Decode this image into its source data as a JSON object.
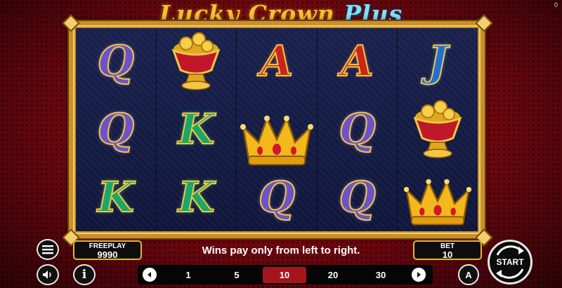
{
  "game": {
    "title_main": "Lucky Crown ",
    "title_plus": "Plus",
    "corner_counter": "0"
  },
  "reels": [
    [
      "Q",
      "Q",
      "K"
    ],
    [
      "pot-of-gold",
      "K",
      "K"
    ],
    [
      "A",
      "crown",
      "Q"
    ],
    [
      "A",
      "Q",
      "Q"
    ],
    [
      "J",
      "pot-of-gold",
      "crown"
    ]
  ],
  "status": {
    "freeplay_label": "FREEPLAY",
    "freeplay_value": "9990",
    "message": "Wins pay only from left to right.",
    "bet_label": "BET",
    "bet_value": "10"
  },
  "bet_options": {
    "values": [
      "1",
      "5",
      "10",
      "20",
      "30"
    ],
    "selected": "10"
  },
  "buttons": {
    "start_label": "START",
    "info_label": "i",
    "autoplay_label": "A"
  },
  "colors": {
    "frame_gold": "#c8902a",
    "selected_bet": "#a8141c",
    "reel_bg": "#141a40"
  }
}
